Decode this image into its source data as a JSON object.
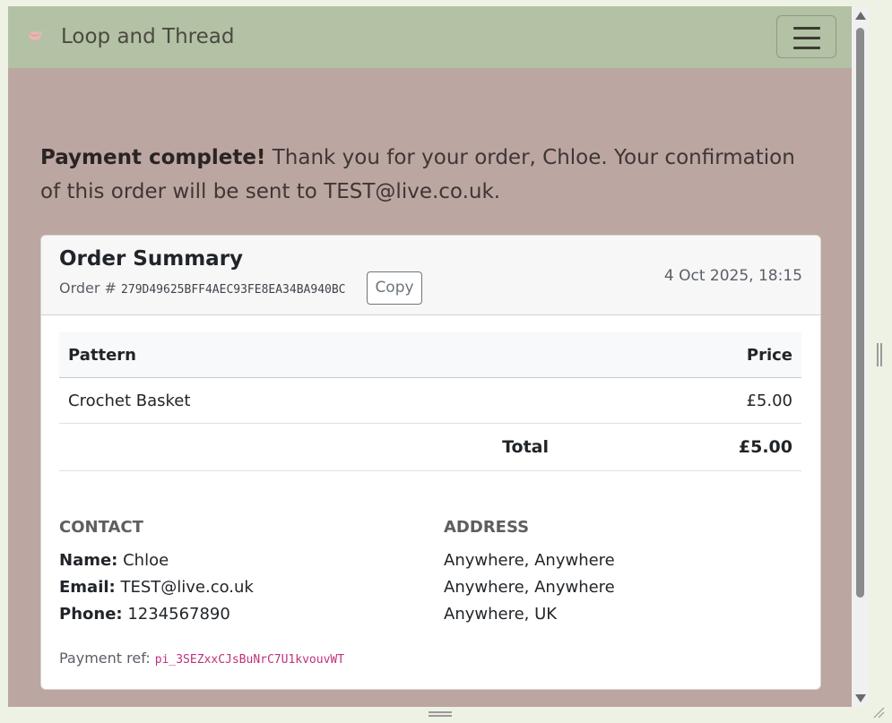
{
  "app": {
    "title": "Loop and Thread"
  },
  "navbar": {
    "brand": "Loop and Thread",
    "brand_icon": "yarn-icon",
    "menu_icon": "hamburger-menu-icon"
  },
  "message": {
    "strong": "Payment complete!",
    "text": " Thank you for your order, Chloe. Your confirmation of this order will be sent to TEST@live.co.uk."
  },
  "order": {
    "title": "Order Summary",
    "number_label": "Order # ",
    "number": "279D49625BFF4AEC93FE8EA34BA940BC",
    "copy_label": "Copy",
    "date": "4 Oct 2025, 18:15"
  },
  "table": {
    "headers": [
      "Pattern",
      "Price"
    ],
    "rows": [
      {
        "pattern": "Crochet Basket",
        "price": "£5.00"
      }
    ],
    "total_label": "Total",
    "total_value": "£5.00"
  },
  "contact": {
    "heading": "CONTACT",
    "name_label": "Name:",
    "name": " Chloe",
    "email_label": "Email:",
    "email": " TEST@live.co.uk",
    "phone_label": "Phone:",
    "phone": " 1234567890"
  },
  "address": {
    "heading": "ADDRESS",
    "lines": [
      "Anywhere, Anywhere",
      "Anywhere, Anywhere",
      "Anywhere, UK"
    ]
  },
  "payment": {
    "label": "Payment ref: ",
    "ref": "pi_3SEZxxCJsBuNrC7U1kvouvWT"
  },
  "colors": {
    "navbar": "#b3c1a4",
    "page": "#bca6a1",
    "card": "#ffffff",
    "code": "#c0307a"
  }
}
